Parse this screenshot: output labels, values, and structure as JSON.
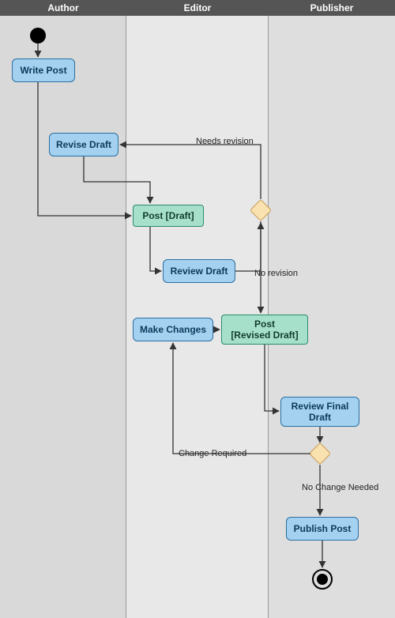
{
  "diagram": {
    "type": "activity-diagram",
    "lanes": {
      "author": "Author",
      "editor": "Editor",
      "publisher": "Publisher"
    },
    "nodes": {
      "write_post": "Write Post",
      "revise_draft": "Revise Draft",
      "post_draft": "Post [Draft]",
      "review_draft": "Review Draft",
      "make_changes": "Make Changes",
      "post_revised": "Post\n[Revised Draft]",
      "review_final": "Review Final\nDraft",
      "publish_post": "Publish Post"
    },
    "edges": {
      "needs_revision": "Needs revision",
      "no_revision": "No revision",
      "change_required": "Change Required",
      "no_change_needed": "No Change Needed"
    }
  },
  "chart_data": {
    "type": "flowchart",
    "title": "",
    "swimlanes": [
      "Author",
      "Editor",
      "Publisher"
    ],
    "nodes": [
      {
        "id": "start",
        "type": "initial",
        "lane": "Author",
        "label": ""
      },
      {
        "id": "write_post",
        "type": "activity",
        "lane": "Author",
        "label": "Write Post"
      },
      {
        "id": "revise_draft",
        "type": "activity",
        "lane": "Author",
        "label": "Revise Draft"
      },
      {
        "id": "post_draft",
        "type": "object",
        "lane": "Editor",
        "label": "Post [Draft]"
      },
      {
        "id": "review_draft",
        "type": "activity",
        "lane": "Editor",
        "label": "Review Draft"
      },
      {
        "id": "decision1",
        "type": "decision",
        "lane": "Editor",
        "label": ""
      },
      {
        "id": "make_changes",
        "type": "activity",
        "lane": "Editor",
        "label": "Make Changes"
      },
      {
        "id": "post_revised",
        "type": "object",
        "lane": "Editor",
        "label": "Post [Revised Draft]"
      },
      {
        "id": "review_final",
        "type": "activity",
        "lane": "Publisher",
        "label": "Review Final Draft"
      },
      {
        "id": "decision2",
        "type": "decision",
        "lane": "Publisher",
        "label": ""
      },
      {
        "id": "publish_post",
        "type": "activity",
        "lane": "Publisher",
        "label": "Publish Post"
      },
      {
        "id": "end",
        "type": "final",
        "lane": "Publisher",
        "label": ""
      }
    ],
    "edges": [
      {
        "from": "start",
        "to": "write_post",
        "label": ""
      },
      {
        "from": "write_post",
        "to": "post_draft",
        "label": ""
      },
      {
        "from": "revise_draft",
        "to": "post_draft",
        "label": ""
      },
      {
        "from": "post_draft",
        "to": "review_draft",
        "label": ""
      },
      {
        "from": "review_draft",
        "to": "decision1",
        "label": ""
      },
      {
        "from": "decision1",
        "to": "revise_draft",
        "label": "Needs revision"
      },
      {
        "from": "decision1",
        "to": "post_revised",
        "label": "No revision"
      },
      {
        "from": "post_revised",
        "to": "review_final",
        "label": ""
      },
      {
        "from": "review_final",
        "to": "decision2",
        "label": ""
      },
      {
        "from": "decision2",
        "to": "make_changes",
        "label": "Change Required"
      },
      {
        "from": "make_changes",
        "to": "post_revised",
        "label": ""
      },
      {
        "from": "decision2",
        "to": "publish_post",
        "label": "No Change Needed"
      },
      {
        "from": "publish_post",
        "to": "end",
        "label": ""
      }
    ]
  }
}
